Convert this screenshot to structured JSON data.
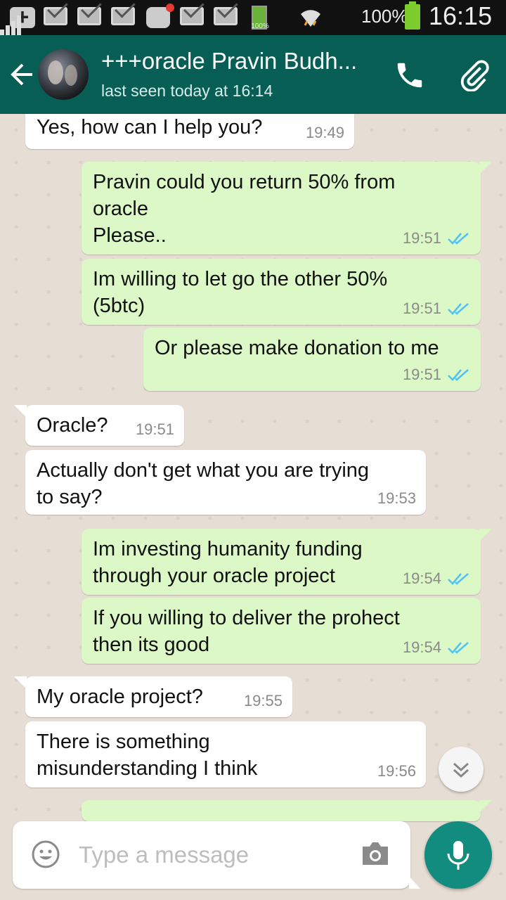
{
  "status_bar": {
    "battery_small_label": "100%",
    "battery_percent": "100%",
    "time": "16:15"
  },
  "header": {
    "contact_name": "+++oracle Pravin Budh...",
    "last_seen": "last seen today at 16:14"
  },
  "messages": [
    {
      "direction": "in",
      "text": "Yes, how can I help you?",
      "time": "19:49"
    },
    {
      "direction": "out",
      "text": "Pravin could you return 50% from\noracle\nPlease..",
      "time": "19:51",
      "status": "read"
    },
    {
      "direction": "out",
      "text": "Im willing to let go the other 50%\n(5btc)",
      "time": "19:51",
      "status": "read"
    },
    {
      "direction": "out",
      "text": "Or please make donation to me",
      "time": "19:51",
      "status": "read"
    },
    {
      "direction": "in",
      "text": "Oracle?",
      "time": "19:51"
    },
    {
      "direction": "in",
      "text": "Actually don't get what you are trying\nto say?",
      "time": "19:53"
    },
    {
      "direction": "out",
      "text": "Im investing humanity funding\nthrough your oracle project",
      "time": "19:54",
      "status": "read"
    },
    {
      "direction": "out",
      "text": "If you willing to deliver the prohect\nthen its good",
      "time": "19:54",
      "status": "read"
    },
    {
      "direction": "in",
      "text": "My oracle project?",
      "time": "19:55"
    },
    {
      "direction": "in",
      "text": "There is something\nmisunderstanding I think",
      "time": "19:56"
    }
  ],
  "compose": {
    "placeholder": "Type a message"
  },
  "colors": {
    "header": "#075e54",
    "outgoing_bubble": "#dcf8c6",
    "incoming_bubble": "#ffffff",
    "read_ticks": "#4fc3f7",
    "mic_button": "#128c7e"
  }
}
